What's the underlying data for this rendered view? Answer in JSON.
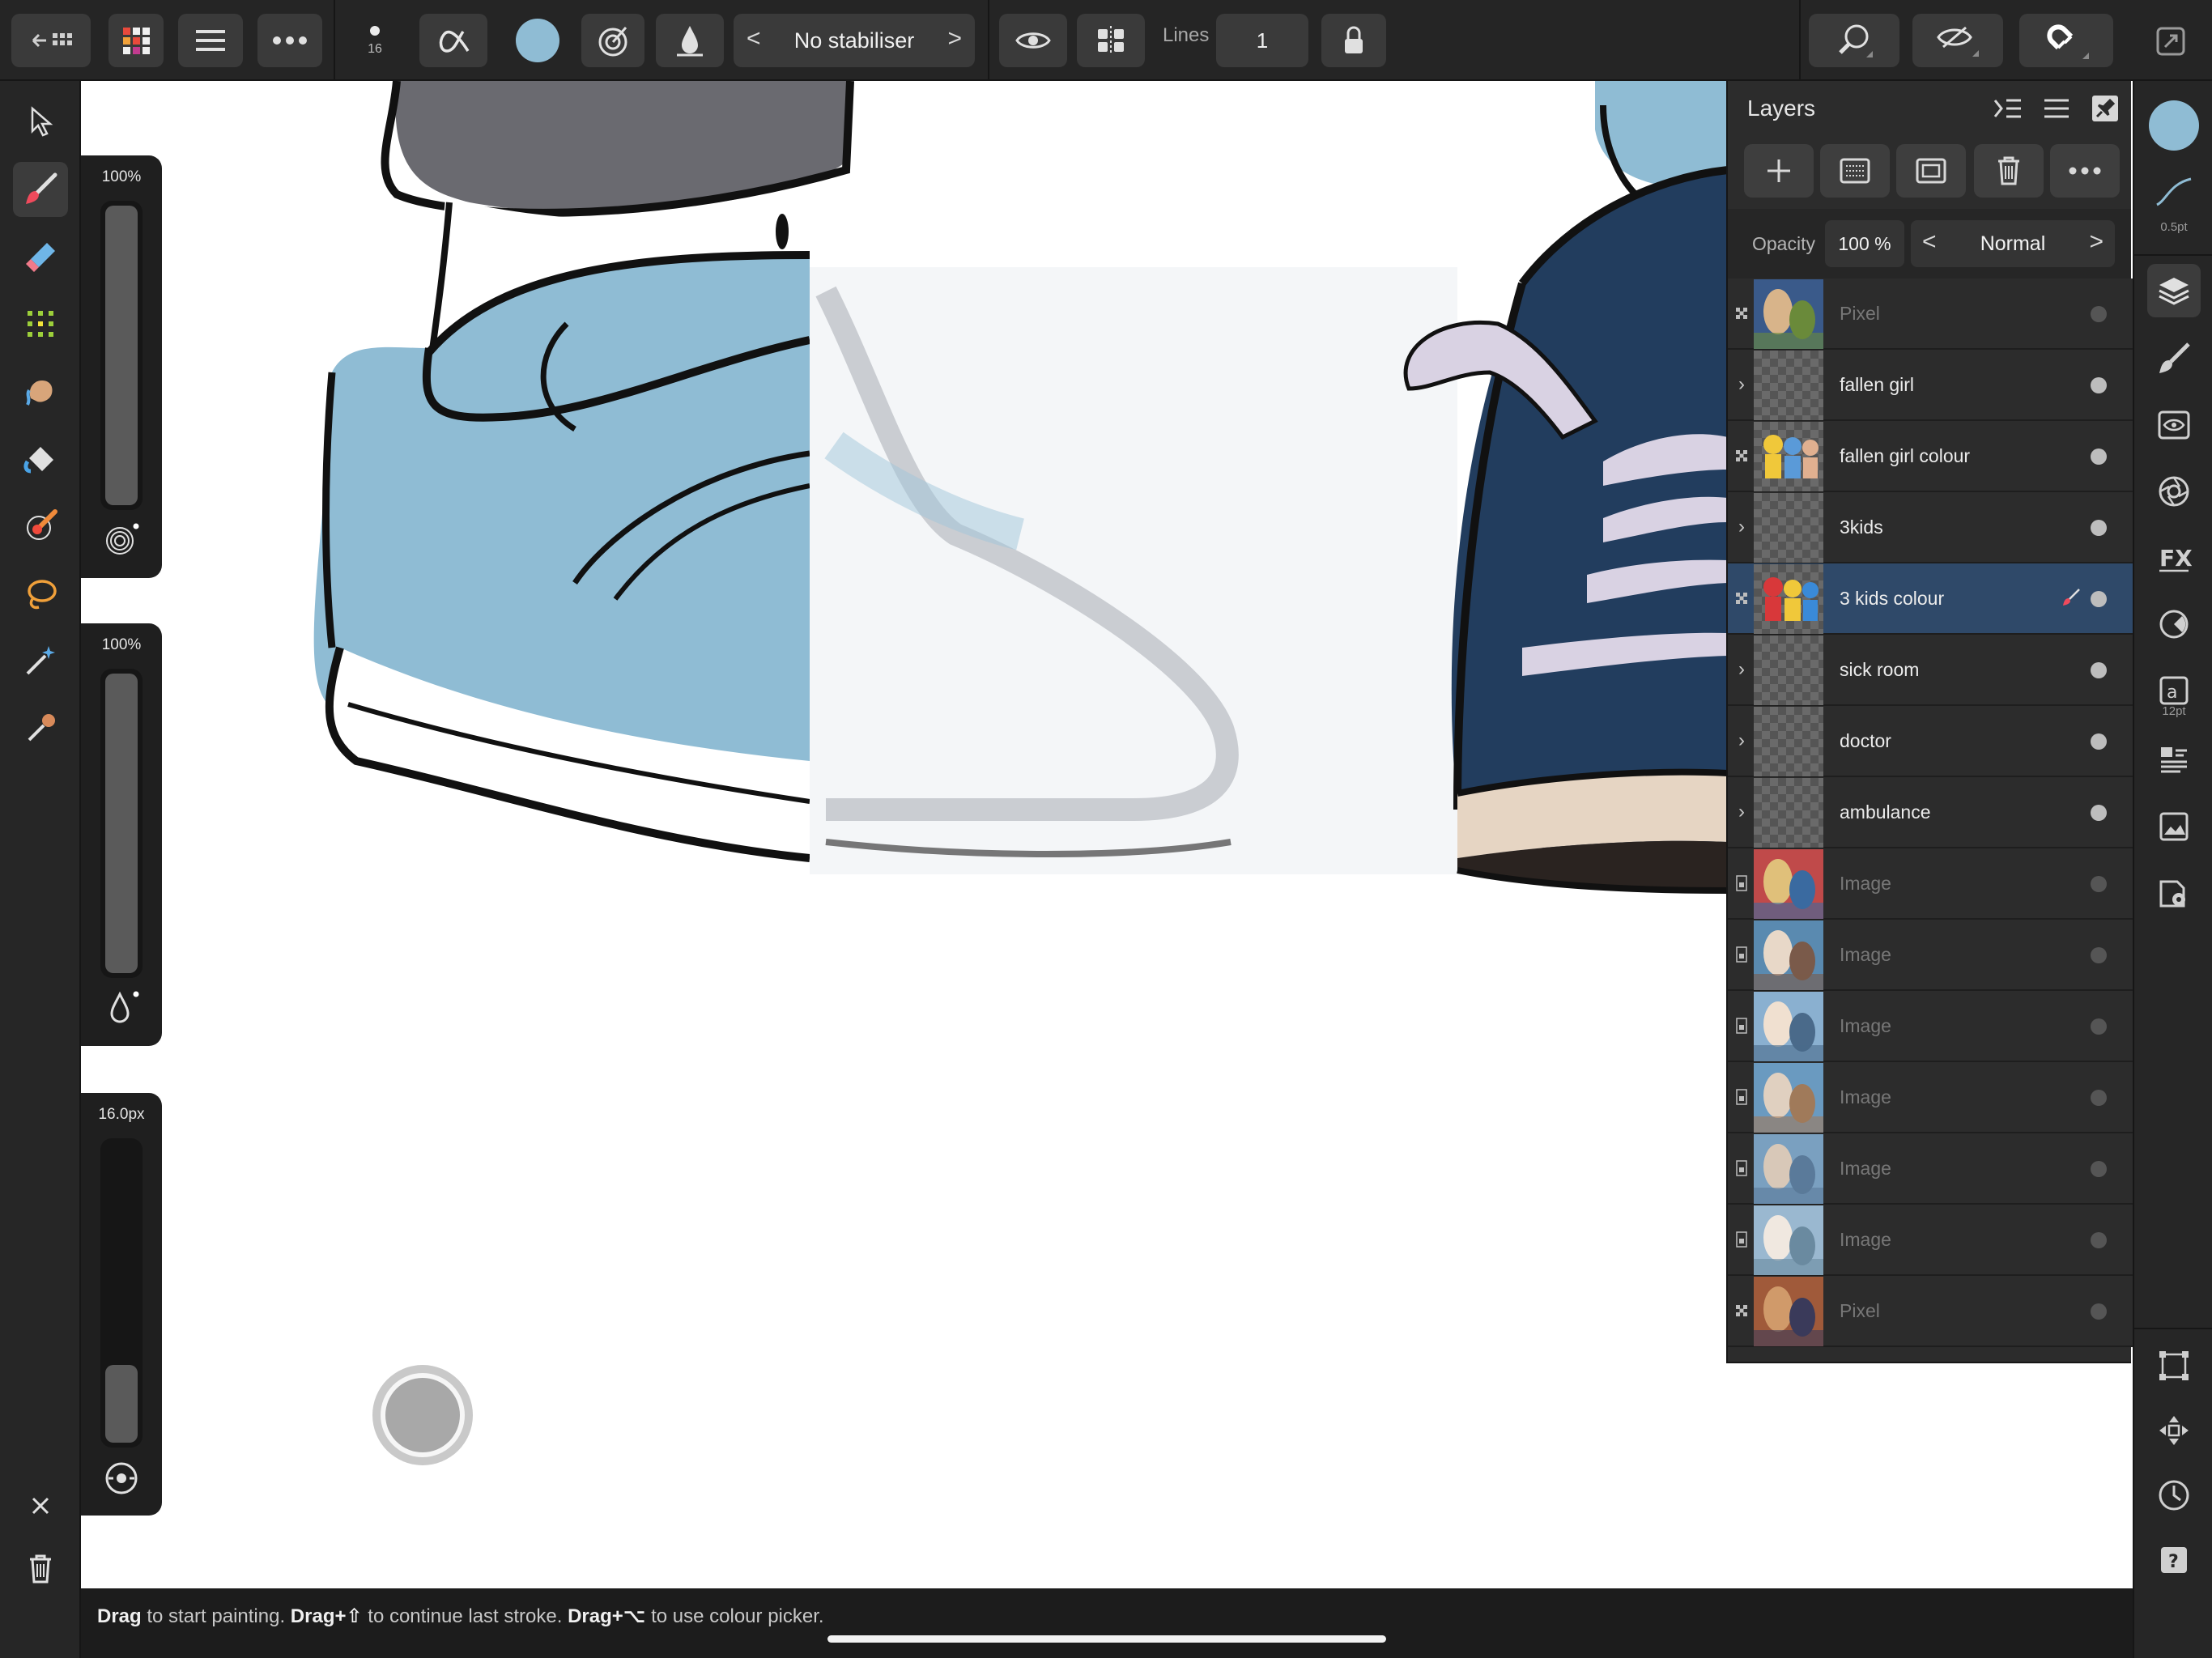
{
  "toolbar": {
    "brush_size_value": "16",
    "stabiliser_label": "No stabiliser",
    "stabiliser_prev": "<",
    "stabiliser_next": ">",
    "lines_label": "Lines",
    "lines_value": "1",
    "colour_swatch": "#8fbcd4"
  },
  "sliders": {
    "opacity_value": "100%",
    "flow_value": "100%",
    "size_value": "16.0px",
    "opacity_level": 1.0,
    "flow_level": 1.0,
    "size_level": 0.26
  },
  "layers_panel": {
    "title": "Layers",
    "opacity_label": "Opacity",
    "opacity_value": "100 %",
    "blend_mode": "Normal",
    "blend_prev": "<",
    "blend_next": ">",
    "layers": [
      {
        "name": "Pixel",
        "kind": "pixel",
        "dim": true,
        "selected": false
      },
      {
        "name": "fallen girl",
        "kind": "group",
        "dim": false,
        "selected": false
      },
      {
        "name": "fallen girl colour",
        "kind": "pixel",
        "dim": false,
        "selected": false
      },
      {
        "name": "3kids",
        "kind": "group",
        "dim": false,
        "selected": false
      },
      {
        "name": "3 kids colour",
        "kind": "pixel",
        "dim": false,
        "selected": true
      },
      {
        "name": "sick room",
        "kind": "group",
        "dim": false,
        "selected": false
      },
      {
        "name": "doctor",
        "kind": "group",
        "dim": false,
        "selected": false
      },
      {
        "name": "ambulance",
        "kind": "group",
        "dim": false,
        "selected": false
      },
      {
        "name": "Image",
        "kind": "image",
        "dim": true,
        "selected": false
      },
      {
        "name": "Image",
        "kind": "image",
        "dim": true,
        "selected": false
      },
      {
        "name": "Image",
        "kind": "image",
        "dim": true,
        "selected": false
      },
      {
        "name": "Image",
        "kind": "image",
        "dim": true,
        "selected": false
      },
      {
        "name": "Image",
        "kind": "image",
        "dim": true,
        "selected": false
      },
      {
        "name": "Image",
        "kind": "image",
        "dim": true,
        "selected": false
      },
      {
        "name": "Pixel",
        "kind": "pixel",
        "dim": true,
        "selected": false
      }
    ]
  },
  "rightbar": {
    "stroke_width": "0.5pt",
    "font_size": "12pt",
    "colour_swatch": "#8fbcd4"
  },
  "status": {
    "drag1": "Drag",
    "text1": " to start painting. ",
    "drag2": "Drag+⇧",
    "text2": " to continue last stroke. ",
    "drag3": "Drag+⌥",
    "text3": " to use colour picker."
  },
  "colors": {
    "accent_selected": "#2f4969",
    "shoe_light_blue": "#8fbcd4",
    "shoe_navy": "#223d5e",
    "lace_lilac": "#d9d2e3"
  }
}
